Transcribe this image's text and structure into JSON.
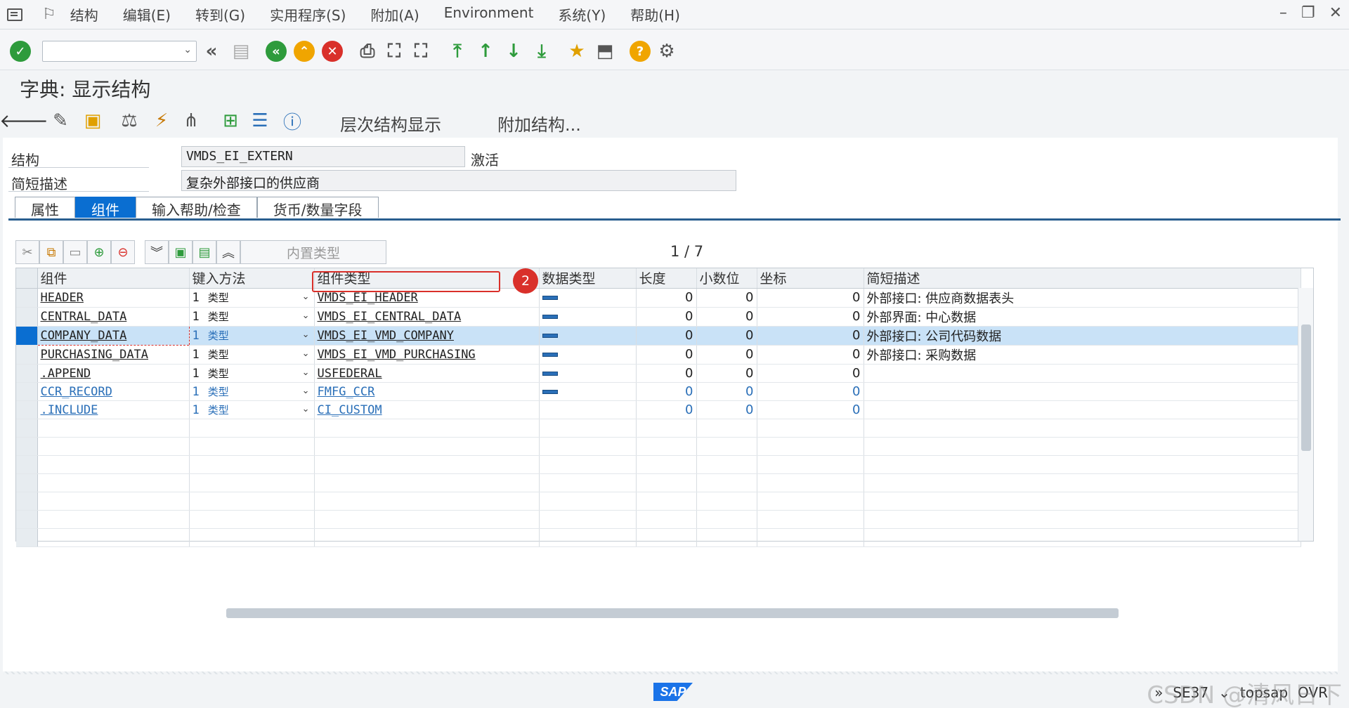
{
  "menubar": {
    "items": [
      "结构",
      "编辑(E)",
      "转到(G)",
      "实用程序(S)",
      "附加(A)",
      "Environment",
      "系统(Y)",
      "帮助(H)"
    ]
  },
  "toolbar": {
    "command_placeholder": ""
  },
  "title": "字典: 显示结构",
  "apptoolbar": {
    "hierarchy_label": "层次结构显示",
    "append_label": "附加结构..."
  },
  "form": {
    "struct_label": "结构",
    "struct_value": "VMDS_EI_EXTERN",
    "status_value": "激活",
    "desc_label": "简短描述",
    "desc_value": "复杂外部接口的供应商"
  },
  "tabs": [
    "属性",
    "组件",
    "输入帮助/检查",
    "货币/数量字段"
  ],
  "table_toolbar": {
    "builtin_type_label": "内置类型",
    "pager": "1 / 7"
  },
  "grid": {
    "headers": [
      "组件",
      "键入方法",
      "组件类型",
      "数据类型",
      "长度",
      "小数位",
      "坐标",
      "简短描述"
    ],
    "method_type": "类型",
    "rows": [
      {
        "comp": "HEADER",
        "method": "1",
        "ctype": "VMDS_EI_HEADER",
        "len": "0",
        "dec": "0",
        "coord": "0",
        "desc": "外部接口: 供应商数据表头"
      },
      {
        "comp": "CENTRAL_DATA",
        "method": "1",
        "ctype": "VMDS_EI_CENTRAL_DATA",
        "len": "0",
        "dec": "0",
        "coord": "0",
        "desc": "外部界面: 中心数据"
      },
      {
        "comp": "COMPANY_DATA",
        "method": "1",
        "ctype": "VMDS_EI_VMD_COMPANY",
        "len": "0",
        "dec": "0",
        "coord": "0",
        "desc": "外部接口: 公司代码数据"
      },
      {
        "comp": "PURCHASING_DATA",
        "method": "1",
        "ctype": "VMDS_EI_VMD_PURCHASING",
        "len": "0",
        "dec": "0",
        "coord": "0",
        "desc": "外部接口: 采购数据"
      },
      {
        "comp": ".APPEND",
        "method": "1",
        "ctype": "USFEDERAL",
        "len": "0",
        "dec": "0",
        "coord": "0",
        "desc": ""
      },
      {
        "comp": "CCR_RECORD",
        "method": "1",
        "ctype": "FMFG_CCR",
        "len": "0",
        "dec": "0",
        "coord": "0",
        "desc": ""
      },
      {
        "comp": ".INCLUDE",
        "method": "1",
        "ctype": "CI_CUSTOM",
        "len": "0",
        "dec": "0",
        "coord": "0",
        "desc": ""
      }
    ]
  },
  "annotation": "2",
  "status": {
    "tcode": "SE37",
    "server": "topsap",
    "mode": "OVR",
    "watermark": "CSDN @清风日下"
  },
  "colors": {
    "accent": "#0a6ed1",
    "annotation_red": "#d9302a",
    "link_blue": "#2a6fb8"
  }
}
